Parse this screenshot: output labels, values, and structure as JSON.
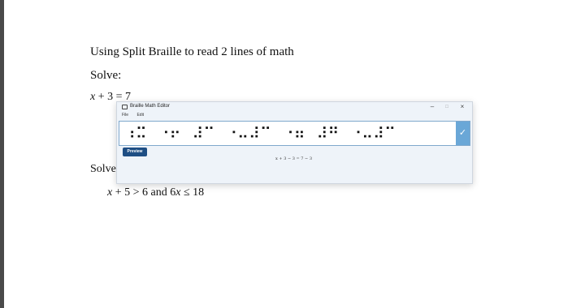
{
  "document": {
    "heading": "Using Split Braille to read 2 lines of math",
    "solve_label_1": "Solve:",
    "equation_1": {
      "var": "x",
      "rest": " + 3 = 7"
    },
    "solve_label_2": "Solve the",
    "equation_2": {
      "var1": "x",
      "part1": " + 5 > 6 and 6",
      "var2": "x",
      "part2": " ≤ 18"
    }
  },
  "editor": {
    "title": "Braille Math Editor",
    "menu": [
      "File",
      "Edit"
    ],
    "window_buttons": {
      "minimize": "–",
      "maximize": "□",
      "close": "×"
    },
    "braille_input": "⠰⠭⠀⠐⠖⠀⠼⠉⠀⠐⠤⠼⠉⠀⠐⠶⠀⠼⠛⠀⠐⠤⠼⠉",
    "check_icon": "✓",
    "preview_label": "Preview",
    "preview_output": "x + 3 − 3 = 7 − 3"
  }
}
